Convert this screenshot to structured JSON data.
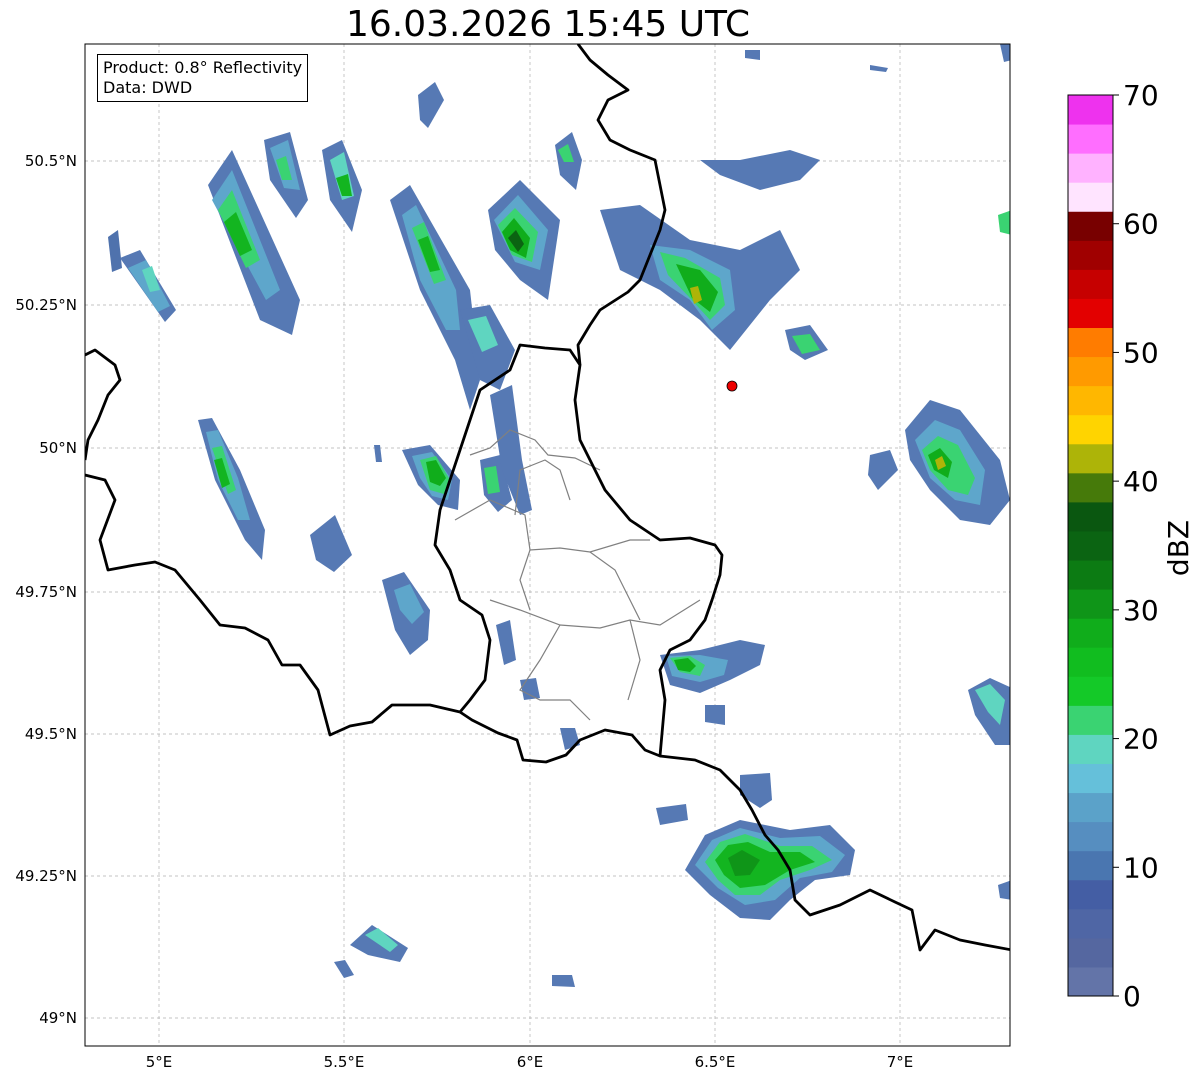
{
  "title": "16.03.2026 15:45 UTC",
  "info": {
    "product": "Product: 0.8° Reflectivity",
    "data_source": "Data: DWD"
  },
  "axes": {
    "x_ticks": [
      "5°E",
      "5.5°E",
      "6°E",
      "6.5°E",
      "7°E"
    ],
    "y_ticks": [
      "50.5°N",
      "50.25°N",
      "50°N",
      "49.75°N",
      "49.5°N",
      "49.25°N",
      "49°N"
    ]
  },
  "colorbar": {
    "label": "dBZ",
    "ticks": [
      "0",
      "10",
      "20",
      "30",
      "40",
      "50",
      "60",
      "70"
    ],
    "colors": [
      "#6374a8",
      "#5567a0",
      "#4f66a5",
      "#445ea4",
      "#4a76b0",
      "#568ec0",
      "#5ba2c9",
      "#65c0da",
      "#5fd5c0",
      "#3ad372",
      "#14c928",
      "#11bd1f",
      "#10ad1b",
      "#0f9518",
      "#0c7b13",
      "#0b6412",
      "#0a5710",
      "#467a0a",
      "#adb408",
      "#ffd400",
      "#ffb700",
      "#ff9a00",
      "#ff7c00",
      "#e30000",
      "#c60000",
      "#a00000",
      "#780000",
      "#ffe4ff",
      "#ffb2ff",
      "#ff6eff",
      "#ee32ee"
    ]
  },
  "marker": {
    "color": "#ee0000",
    "lon": 6.55,
    "lat": 50.11
  },
  "chart_data": {
    "type": "heatmap",
    "title": "16.03.2026 15:45 UTC",
    "xlim": [
      4.8,
      7.3
    ],
    "ylim": [
      48.95,
      50.7
    ],
    "colorbar_range": [
      0,
      70
    ],
    "colorbar_unit": "dBZ"
  }
}
